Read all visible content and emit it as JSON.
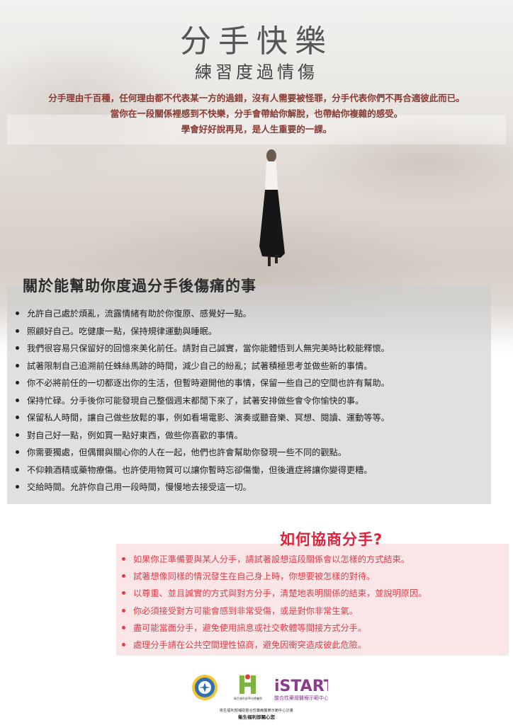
{
  "header": {
    "title": "分手快樂",
    "subtitle": "練習度過情傷"
  },
  "intro": {
    "line1": "分手理由千百種，任何理由都不代表某一方的過錯，沒有人需要被怪罪，分手代表你們不再合適彼此而已。",
    "line2": "當你在一段關係裡感到不快樂，分手會帶給你解脫，也帶給你複雜的感受。",
    "line3": "學會好好說再見，是人生重要的一課。"
  },
  "help_section": {
    "title": "關於能幫助你度過分手後傷痛的事",
    "items": [
      "允許自己處於煩亂，流露情緒有助於你復原、感覺好一點。",
      "照顧好自己。吃健康一點，保持規律運動與睡眠。",
      "我們很容易只保留好的回憶來美化前任。請對自己誠實，當你能體悟到人無完美時比較能釋懷。",
      "試著限制自己追溯前任蛛絲馬跡的時間，減少自己的紛亂；試著積極思考並做些新的事情。",
      "你不必將前任的一切都逐出你的生活，但暫時避開他的事情，保留一些自己的空間也許有幫助。",
      "保持忙碌。分手後你可能發現自己整個週末都閒下來了，試著安排做些會令你愉快的事。",
      "保留私人時間，讓自己做些放鬆的事，例如看場電影、演奏或聽音樂、冥想、閱讀、運動等等。",
      "對自己好一點，例如買一點好東西，做些你喜歡的事情。",
      "你需要獨處，但偶爾與關心你的人在一起，他們也許會幫助你發現一些不同的觀點。",
      "不仰賴酒精或藥物療傷。也許使用物質可以讓你暫時忘卻傷慟，但後遺症將讓你變得更糟。",
      "交給時間。允許你自己用一段時間，慢慢地去接受這一切。"
    ]
  },
  "negotiate_section": {
    "title": "如何協商分手?",
    "items": [
      "如果你正準備要與某人分手，請試著設想這段關係會以怎樣的方式結束。",
      "試著想像同樣的情況發生在自己身上時，你想要被怎樣的對待。",
      "以尊重、並且誠實的方式與對方分手，清楚地表明關係的結束，並說明原因。",
      "你必須接受對方可能會感到非常受傷，或是對你非常生氣。",
      "盡可能當面分手，避免使用訊息或社交軟體等間接方式分手。",
      "處理分手請在公共空間理性協商，避免因衝突造成彼此危險。"
    ]
  },
  "logos": {
    "seal_icon": "ministry-seal-icon",
    "h_logo_icon": "health-h-logo-icon",
    "istart": "iSTART",
    "istart_sub": "整合性藥癮醫療示範中心",
    "h_logo_sub": "衛生福利部草屯療養院"
  },
  "footer": {
    "line1": "衛生福利部補助整合性藥癮醫療示範中心計畫",
    "line2": "衛生福利部關心您"
  },
  "colors": {
    "intro_text": "#8a3a33",
    "negotiate_title": "#e3203a",
    "negotiate_text": "#dc3d4a",
    "negotiate_bg": "#fbe6e7",
    "help_panel_bg": "#cdcdcd"
  }
}
